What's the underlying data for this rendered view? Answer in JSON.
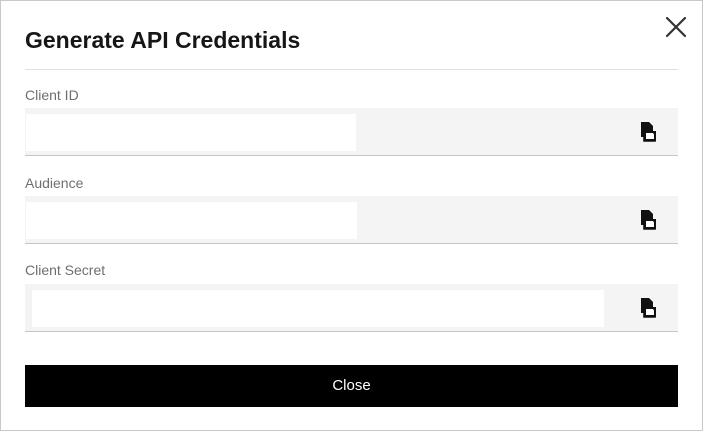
{
  "dialog": {
    "title": "Generate API Credentials",
    "close_icon": "close-icon"
  },
  "fields": [
    {
      "label": "Client ID",
      "value": "",
      "copy_icon": "copy-icon"
    },
    {
      "label": "Audience",
      "value": "",
      "copy_icon": "copy-icon"
    },
    {
      "label": "Client Secret",
      "value": "",
      "copy_icon": "copy-icon"
    }
  ],
  "footer": {
    "close_label": "Close"
  },
  "colors": {
    "primary_button": "#000000",
    "field_background": "#f4f4f4",
    "title_text": "#161616",
    "label_text": "#6f6f6f"
  }
}
